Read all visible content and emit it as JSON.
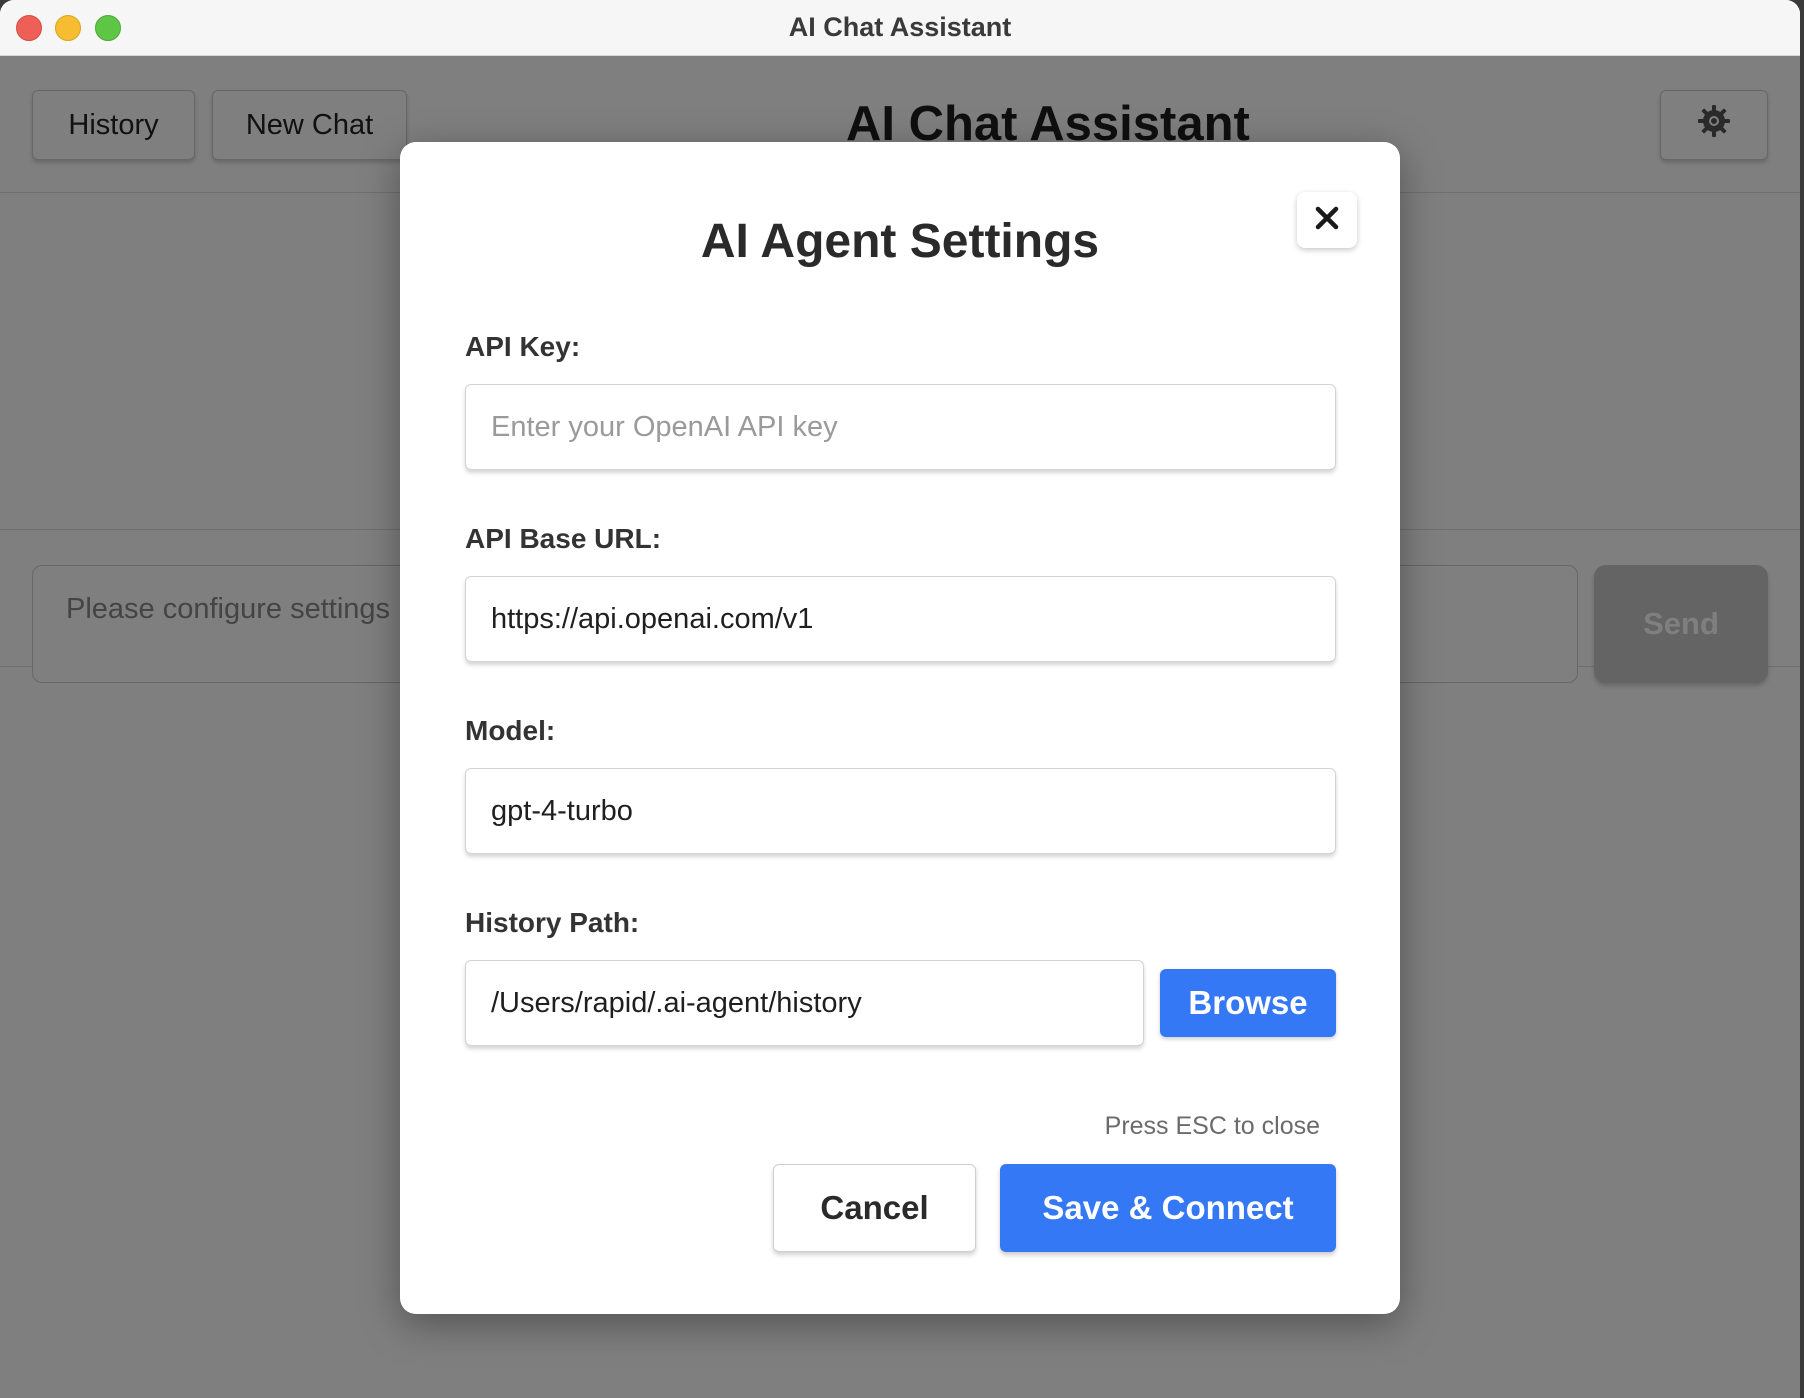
{
  "window": {
    "title": "AI Chat Assistant"
  },
  "toolbar": {
    "history_label": "History",
    "new_chat_label": "New Chat",
    "title": "AI Chat Assistant",
    "settings_icon": "gear-icon"
  },
  "composer": {
    "placeholder": "Please configure settings",
    "send_label": "Send"
  },
  "modal": {
    "title": "AI Agent Settings",
    "close_icon": "close-icon",
    "fields": {
      "api_key": {
        "label": "API Key:",
        "value": "",
        "placeholder": "Enter your OpenAI API key"
      },
      "base_url": {
        "label": "API Base URL:",
        "value": "https://api.openai.com/v1"
      },
      "model": {
        "label": "Model:",
        "value": "gpt-4-turbo"
      },
      "history_path": {
        "label": "History Path:",
        "value": "/Users/rapid/.ai-agent/history"
      }
    },
    "browse_label": "Browse",
    "esc_hint": "Press ESC to close",
    "cancel_label": "Cancel",
    "save_label": "Save & Connect"
  },
  "colors": {
    "accent": "#3478f6",
    "overlay": "rgba(0,0,0,0.5)",
    "traffic_red": "#ee5f57",
    "traffic_yellow": "#f5bd2f",
    "traffic_green": "#5ec545"
  }
}
